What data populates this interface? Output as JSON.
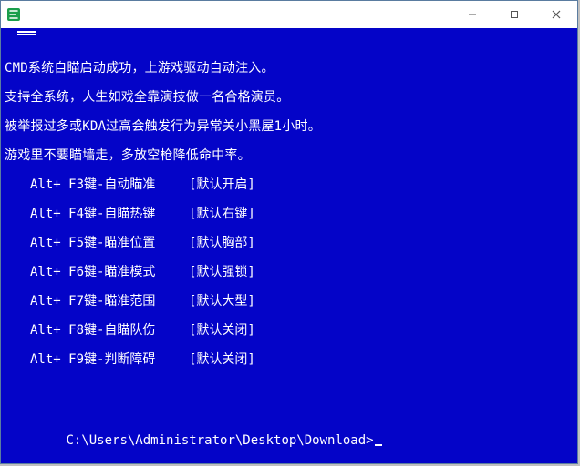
{
  "window": {
    "title": " "
  },
  "controls": {
    "minimize": "—",
    "maximize": "☐",
    "close": "✕"
  },
  "console": {
    "bg": "#0404c8",
    "fg": "#ffffff",
    "lines": [
      "CMD系统自瞄启动成功，上游戏驱动自动注入。",
      "支持全系统，人生如戏全靠演技做一名合格演员。",
      "被举报过多或KDA过高会触发行为异常关小黑屋1小时。",
      "游戏里不要瞄墙走，多放空枪降低命中率。"
    ],
    "hotkeys": [
      {
        "key": "Alt+ F3键-自动瞄准",
        "def": "[默认开启]"
      },
      {
        "key": "Alt+ F4键-自瞄热键",
        "def": "[默认右键]"
      },
      {
        "key": "Alt+ F5键-瞄准位置",
        "def": "[默认胸部]"
      },
      {
        "key": "Alt+ F6键-瞄准模式",
        "def": "[默认强锁]"
      },
      {
        "key": "Alt+ F7键-瞄准范围",
        "def": "[默认大型]"
      },
      {
        "key": "Alt+ F8键-自瞄队伤",
        "def": "[默认关闭]"
      },
      {
        "key": "Alt+ F9键-判断障碍",
        "def": "[默认关闭]"
      }
    ],
    "prompt": "C:\\Users\\Administrator\\Desktop\\Download>"
  }
}
